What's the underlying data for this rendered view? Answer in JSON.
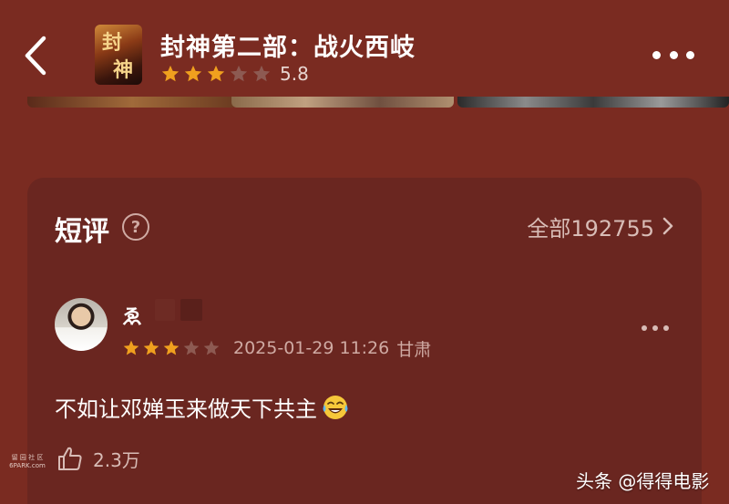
{
  "header": {
    "poster_chars": [
      "封",
      "神"
    ],
    "title": "封神第二部：战火西岐",
    "rating_stars": 3,
    "rating_total": 5,
    "rating_score": "5.8",
    "back_icon": "chevron-left-icon",
    "more_icon": "more-horizontal-icon"
  },
  "short_reviews": {
    "title": "短评",
    "help_icon": "question-circle-icon",
    "help_glyph": "?",
    "all_label": "全部192755",
    "chevron_icon": "chevron-right-icon"
  },
  "review": {
    "username": "ゑ",
    "stars": 3,
    "stars_total": 5,
    "date": "2025-01-29 11:26",
    "location": "甘肃",
    "text": "不如让邓婵玉来做天下共主",
    "emoji_icon": "laughing-tears-emoji-icon",
    "like_icon": "thumbs-up-icon",
    "likes": "2.3万"
  },
  "watermarks": {
    "left_line1": "留 园 社 区",
    "left_line2": "6PARK.com",
    "right": "头条 @得得电影"
  },
  "colors": {
    "background": "#7a2b21",
    "card": "#6a2620",
    "star_filled": "#f0a01e",
    "star_empty": "#8d5a52"
  }
}
